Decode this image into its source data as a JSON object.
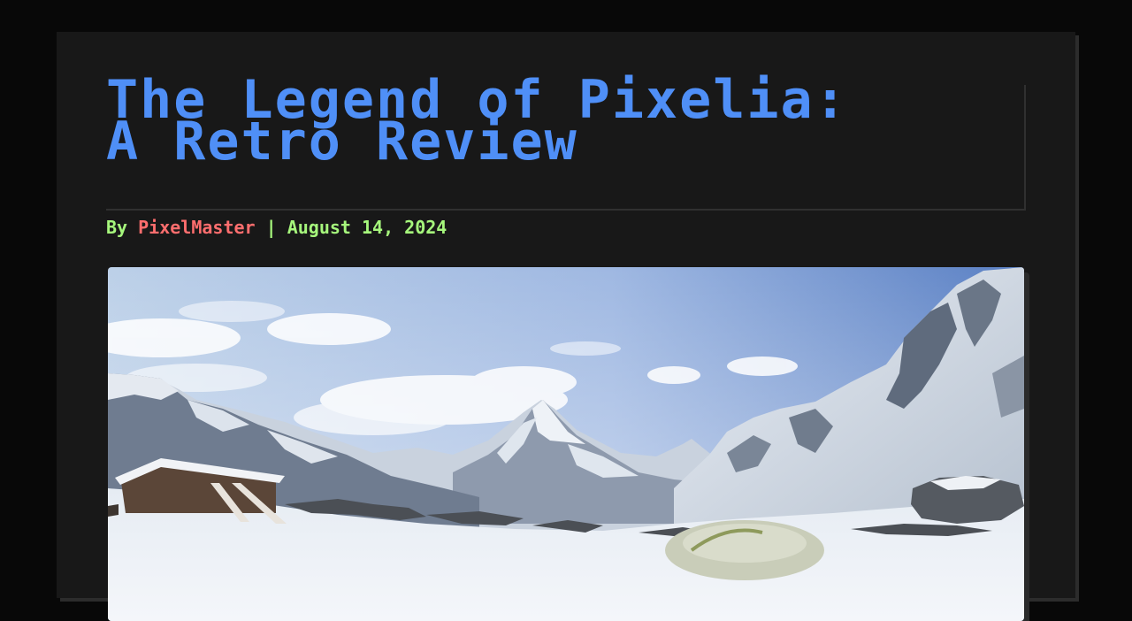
{
  "article": {
    "title": "The Legend of Pixelia: A Retro Review",
    "byline_prefix": "By ",
    "author": "PixelMaster",
    "separator": " | ",
    "date": "August 14, 2024"
  },
  "hero_image": {
    "description_icon": "mountain-landscape-image"
  },
  "colors": {
    "title": "#4f8ff7",
    "byline": "#a6f77c",
    "author": "#ff6e6e",
    "card": "#181818",
    "page": "#080808"
  }
}
